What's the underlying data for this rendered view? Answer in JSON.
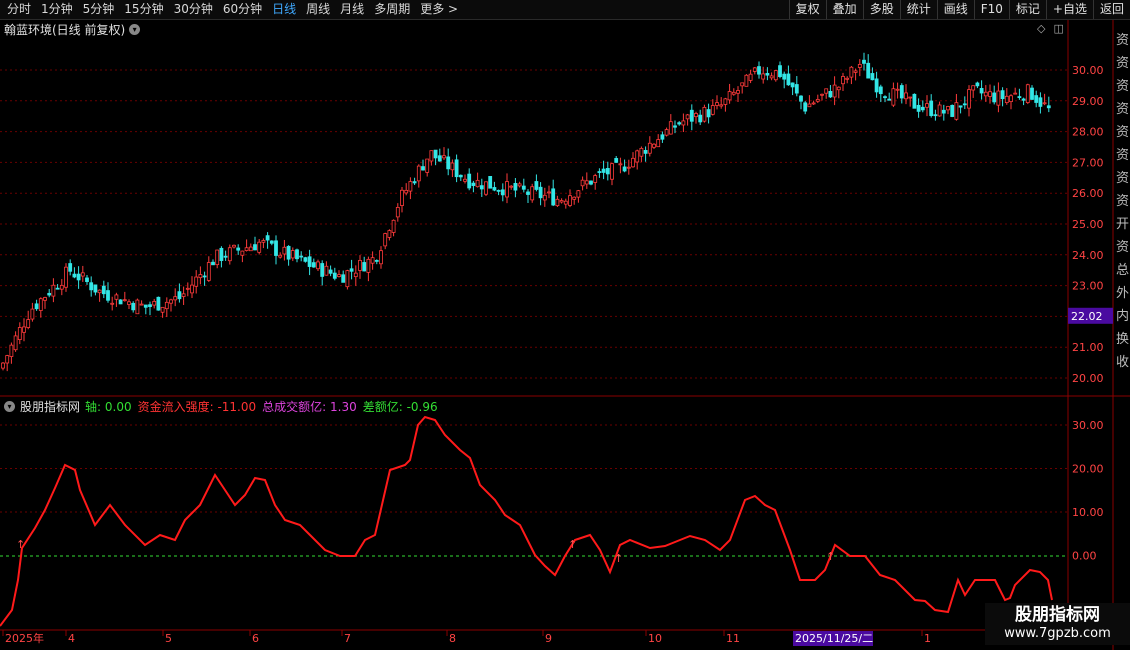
{
  "toolbar": {
    "periods": [
      "分时",
      "1分钟",
      "5分钟",
      "15分钟",
      "30分钟",
      "60分钟",
      "日线",
      "周线",
      "月线",
      "多周期",
      "更多 >"
    ],
    "active_period": "日线",
    "actions": [
      "复权",
      "叠加",
      "多股",
      "统计",
      "画线",
      "F10",
      "标记",
      "+自选",
      "返回"
    ]
  },
  "main_chart": {
    "title": "翰蓝环境(日线 前复权)",
    "price_ticks": [
      "30.00",
      "29.00",
      "28.00",
      "27.00",
      "26.00",
      "25.00",
      "24.00",
      "23.00",
      "22.00",
      "21.00",
      "20.00"
    ],
    "current_price_tag": "22.02"
  },
  "indicator": {
    "name": "股朋指标网",
    "items": [
      {
        "label": "轴: 0.00",
        "color": "#33dd33"
      },
      {
        "label": "资金流入强度: -11.00",
        "color": "#ff3333"
      },
      {
        "label": "总成交额亿: 1.30",
        "color": "#dd44dd"
      },
      {
        "label": "差额亿: -0.96",
        "color": "#33dd33"
      }
    ],
    "ticks": [
      "30.00",
      "20.00",
      "10.00",
      "0.00"
    ]
  },
  "x_axis": {
    "labels": [
      "2025年",
      "4",
      "5",
      "6",
      "7",
      "8",
      "9",
      "10",
      "11",
      "1"
    ],
    "cursor_label": "2025/11/25/二"
  },
  "right_panel_chars": [
    "资",
    "资",
    "资",
    "资",
    "资",
    "资",
    "资",
    "资",
    "开",
    "资",
    "总",
    "外",
    "内",
    "换",
    "收"
  ],
  "watermark": {
    "line1": "股朋指标网",
    "line2": "www.7gpzb.com"
  },
  "colors": {
    "up": "#ff3b3b",
    "down": "#33e6e6",
    "line": "#ff1a1a",
    "axis": "#33dd33",
    "grid": "#6a0000"
  }
}
